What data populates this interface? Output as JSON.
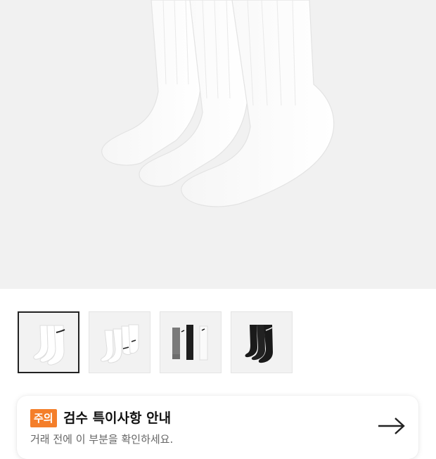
{
  "product": {
    "main_image": "white-crew-socks-three-pack",
    "thumbnails": [
      {
        "name": "white-crew-socks-front",
        "selected": true
      },
      {
        "name": "white-crew-socks-side",
        "selected": false
      },
      {
        "name": "gray-black-white-socks",
        "selected": false
      },
      {
        "name": "black-crew-socks",
        "selected": false
      }
    ]
  },
  "notice": {
    "badge": "주의",
    "title": "검수 특이사항 안내",
    "subtitle": "거래 전에 이 부분을 확인하세요.",
    "arrow_icon": "arrow-right-icon",
    "badge_color": "#f47e2a"
  }
}
